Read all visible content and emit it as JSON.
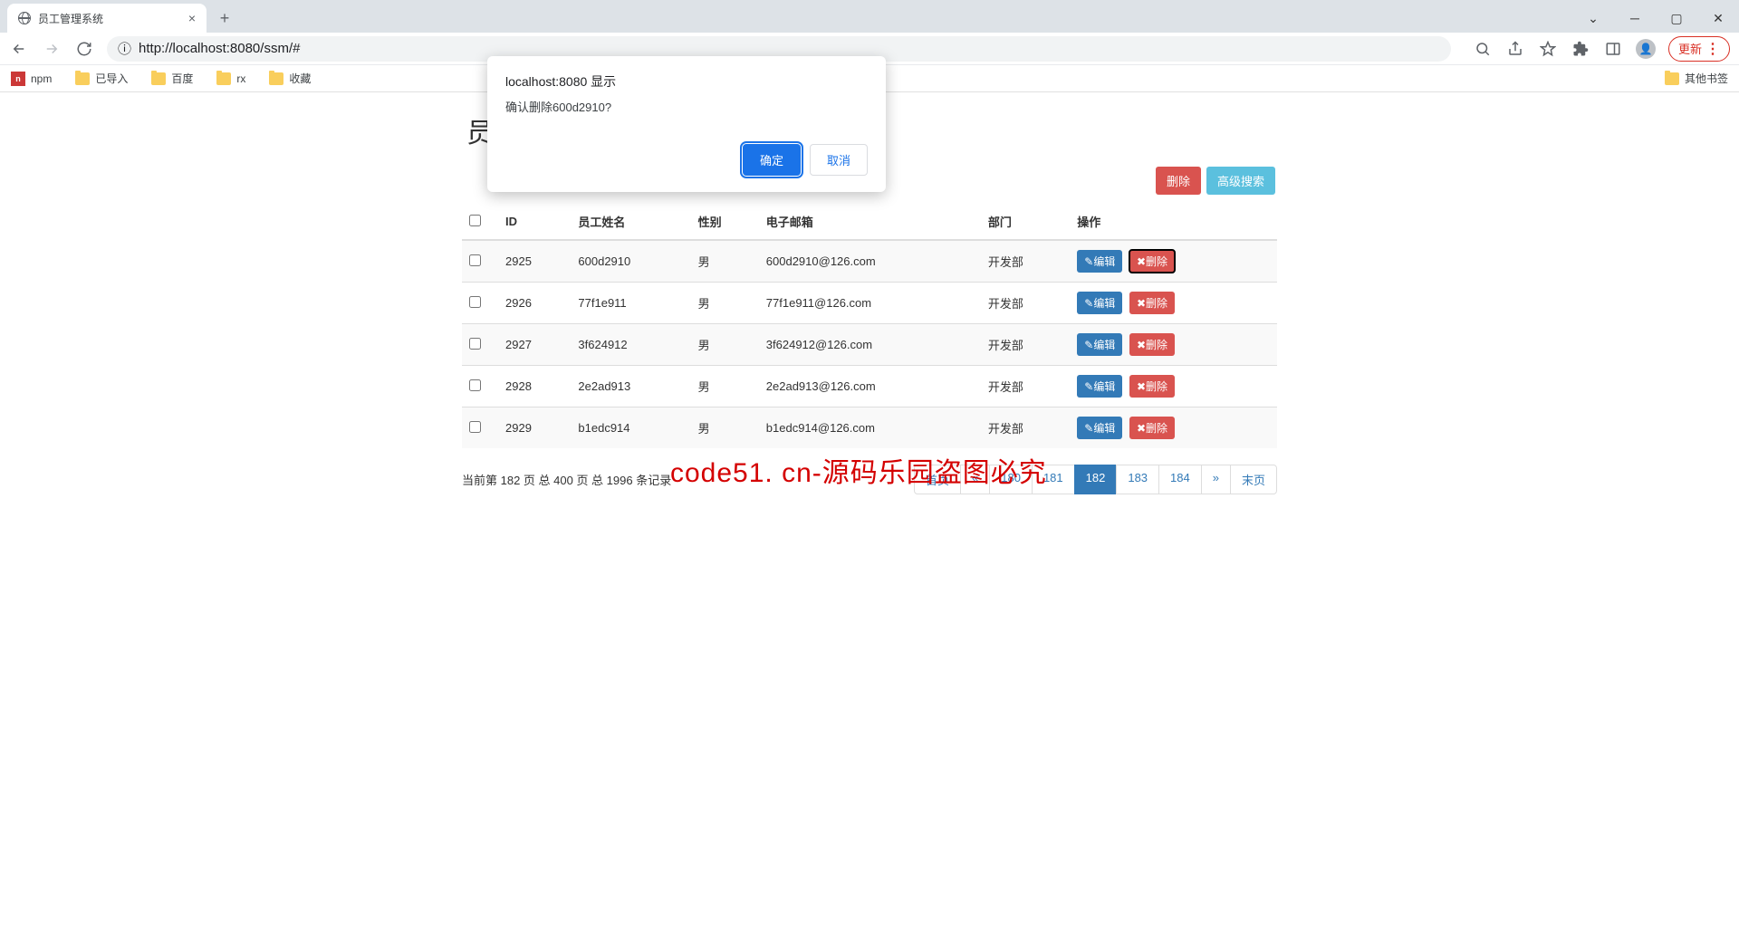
{
  "browser": {
    "tab_title": "员工管理系统",
    "url": "http://localhost:8080/ssm/#",
    "update_button": "更新",
    "bookmarks": [
      "npm",
      "已导入",
      "百度",
      "rx",
      "收藏"
    ],
    "other_bookmarks": "其他书签"
  },
  "app": {
    "title": "员工信息管理系统",
    "buttons": {
      "delete": "删除",
      "advanced_search": "高级搜索",
      "edit": "编辑"
    },
    "headers": {
      "id": "ID",
      "name": "员工姓名",
      "gender": "性别",
      "email": "电子邮箱",
      "dept": "部门",
      "action": "操作"
    },
    "rows": [
      {
        "id": "2925",
        "name": "600d2910",
        "gender": "男",
        "email": "600d2910@126.com",
        "dept": "开发部"
      },
      {
        "id": "2926",
        "name": "77f1e911",
        "gender": "男",
        "email": "77f1e911@126.com",
        "dept": "开发部"
      },
      {
        "id": "2927",
        "name": "3f624912",
        "gender": "男",
        "email": "3f624912@126.com",
        "dept": "开发部"
      },
      {
        "id": "2928",
        "name": "2e2ad913",
        "gender": "男",
        "email": "2e2ad913@126.com",
        "dept": "开发部"
      },
      {
        "id": "2929",
        "name": "b1edc914",
        "gender": "男",
        "email": "b1edc914@126.com",
        "dept": "开发部"
      }
    ],
    "page_info": "当前第 182 页 总 400 页 总 1996 条记录",
    "pagination": {
      "first": "首页",
      "prev": "«",
      "pages": [
        "180",
        "181",
        "182",
        "183",
        "184"
      ],
      "active": "182",
      "next": "»",
      "last": "末页"
    }
  },
  "dialog": {
    "host": "localhost:8080 显示",
    "message": "确认删除600d2910?",
    "ok": "确定",
    "cancel": "取消"
  },
  "watermark": "code51. cn-源码乐园盗图必究"
}
